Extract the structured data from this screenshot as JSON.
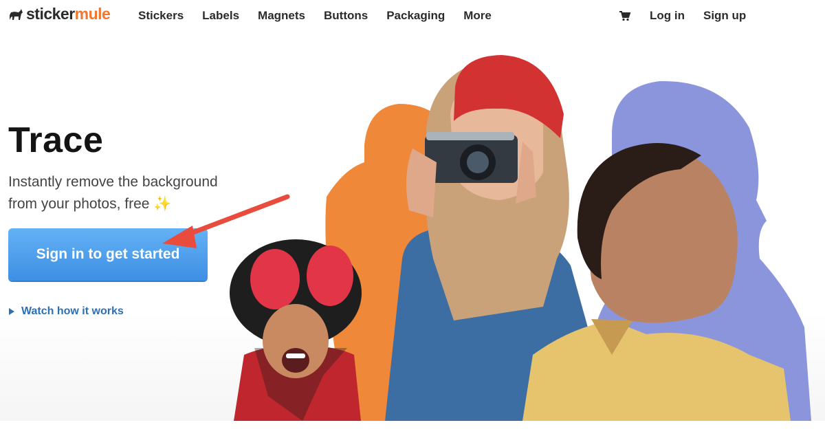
{
  "header": {
    "logo": {
      "part1": "sticker",
      "part2": "mule",
      "icon": "mule-icon"
    },
    "nav": [
      "Stickers",
      "Labels",
      "Magnets",
      "Buttons",
      "Packaging",
      "More"
    ],
    "cart_icon": "cart-icon",
    "login_label": "Log in",
    "signup_label": "Sign up"
  },
  "hero": {
    "title": "Trace",
    "subtitle_line1": "Instantly remove the background",
    "subtitle_line2": "from your photos, free",
    "sparkle": "✨",
    "cta_label": "Sign in to get started",
    "watch_label": "Watch how it works"
  },
  "annotation": {
    "arrow_color": "#e94b3c"
  },
  "colors": {
    "accent": "#3d8fe4",
    "logo_orange": "#f2762e",
    "link": "#2b6fb4",
    "silhouette_orange": "#f0883a",
    "silhouette_purple": "#8b95dc"
  }
}
